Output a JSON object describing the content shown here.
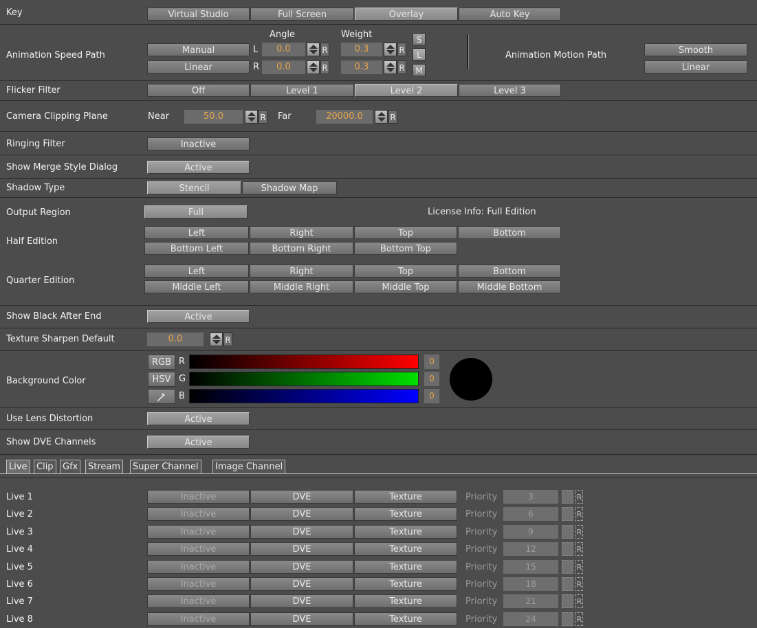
{
  "key": {
    "label": "Key",
    "options": [
      "Virtual Studio",
      "Full Screen",
      "Overlay",
      "Auto Key"
    ],
    "selected": "Overlay"
  },
  "anim_speed": {
    "label": "Animation Speed Path",
    "btn1": "Manual",
    "btn2": "Linear",
    "angle_label": "Angle",
    "weight_label": "Weight",
    "l": "L",
    "r": "R",
    "angle_l": "0.0",
    "angle_r": "0.0",
    "weight_l": "0.3",
    "weight_r": "0.3",
    "reset": "R",
    "s": "S",
    "lbtn": "L",
    "m": "M",
    "motion_label": "Animation Motion Path",
    "motion1": "Smooth",
    "motion2": "Linear"
  },
  "flicker": {
    "label": "Flicker Filter",
    "options": [
      "Off",
      "Level 1",
      "Level 2",
      "Level 3"
    ],
    "selected": "Level 2"
  },
  "clipping": {
    "label": "Camera Clipping Plane",
    "near_label": "Near",
    "near": "50.0",
    "far_label": "Far",
    "far": "20000.0",
    "reset": "R"
  },
  "ringing": {
    "label": "Ringing Filter",
    "value": "Inactive"
  },
  "merge": {
    "label": "Show Merge Style Dialog",
    "value": "Active"
  },
  "shadow": {
    "label": "Shadow Type",
    "options": [
      "Stencil",
      "Shadow Map"
    ],
    "selected": "Stencil"
  },
  "output": {
    "label": "Output Region",
    "value": "Full",
    "license": "License Info: Full Edition"
  },
  "half": {
    "label": "Half Edition",
    "row1": [
      "Left",
      "Right",
      "Top",
      "Bottom"
    ],
    "row2": [
      "Bottom Left",
      "Bottom Right",
      "Bottom Top"
    ]
  },
  "quarter": {
    "label": "Quarter Edition",
    "row1": [
      "Left",
      "Right",
      "Top",
      "Bottom"
    ],
    "row2": [
      "Middle Left",
      "Middle Right",
      "Middle Top",
      "Middle Bottom"
    ]
  },
  "black_end": {
    "label": "Show Black After End",
    "value": "Active"
  },
  "sharpen": {
    "label": "Texture Sharpen Default",
    "value": "0.0",
    "reset": "R"
  },
  "bgcolor": {
    "label": "Background Color",
    "rgb": "RGB",
    "hsv": "HSV",
    "r": "R",
    "g": "G",
    "b": "B",
    "rv": "0",
    "gv": "0",
    "bv": "0",
    "swatch": "#000000",
    "picker_icon": "eyedropper-icon"
  },
  "lens": {
    "label": "Use Lens Distortion",
    "value": "Active"
  },
  "dve": {
    "label": "Show DVE Channels",
    "value": "Active"
  },
  "tabs": [
    "Live",
    "Clip",
    "Gfx",
    "Stream",
    "Super Channel",
    "Image Channel"
  ],
  "live": {
    "priority_label": "Priority",
    "reset": "R",
    "rows": [
      {
        "name": "Live 1",
        "state": "Inactive",
        "mode": "DVE",
        "type": "Texture",
        "priority": "3"
      },
      {
        "name": "Live 2",
        "state": "Inactive",
        "mode": "DVE",
        "type": "Texture",
        "priority": "6"
      },
      {
        "name": "Live 3",
        "state": "Inactive",
        "mode": "DVE",
        "type": "Texture",
        "priority": "9"
      },
      {
        "name": "Live 4",
        "state": "Inactive",
        "mode": "DVE",
        "type": "Texture",
        "priority": "12"
      },
      {
        "name": "Live 5",
        "state": "Inactive",
        "mode": "DVE",
        "type": "Texture",
        "priority": "15"
      },
      {
        "name": "Live 6",
        "state": "Inactive",
        "mode": "DVE",
        "type": "Texture",
        "priority": "18"
      },
      {
        "name": "Live 7",
        "state": "Inactive",
        "mode": "DVE",
        "type": "Texture",
        "priority": "21"
      },
      {
        "name": "Live 8",
        "state": "Inactive",
        "mode": "DVE",
        "type": "Texture",
        "priority": "24"
      }
    ]
  }
}
